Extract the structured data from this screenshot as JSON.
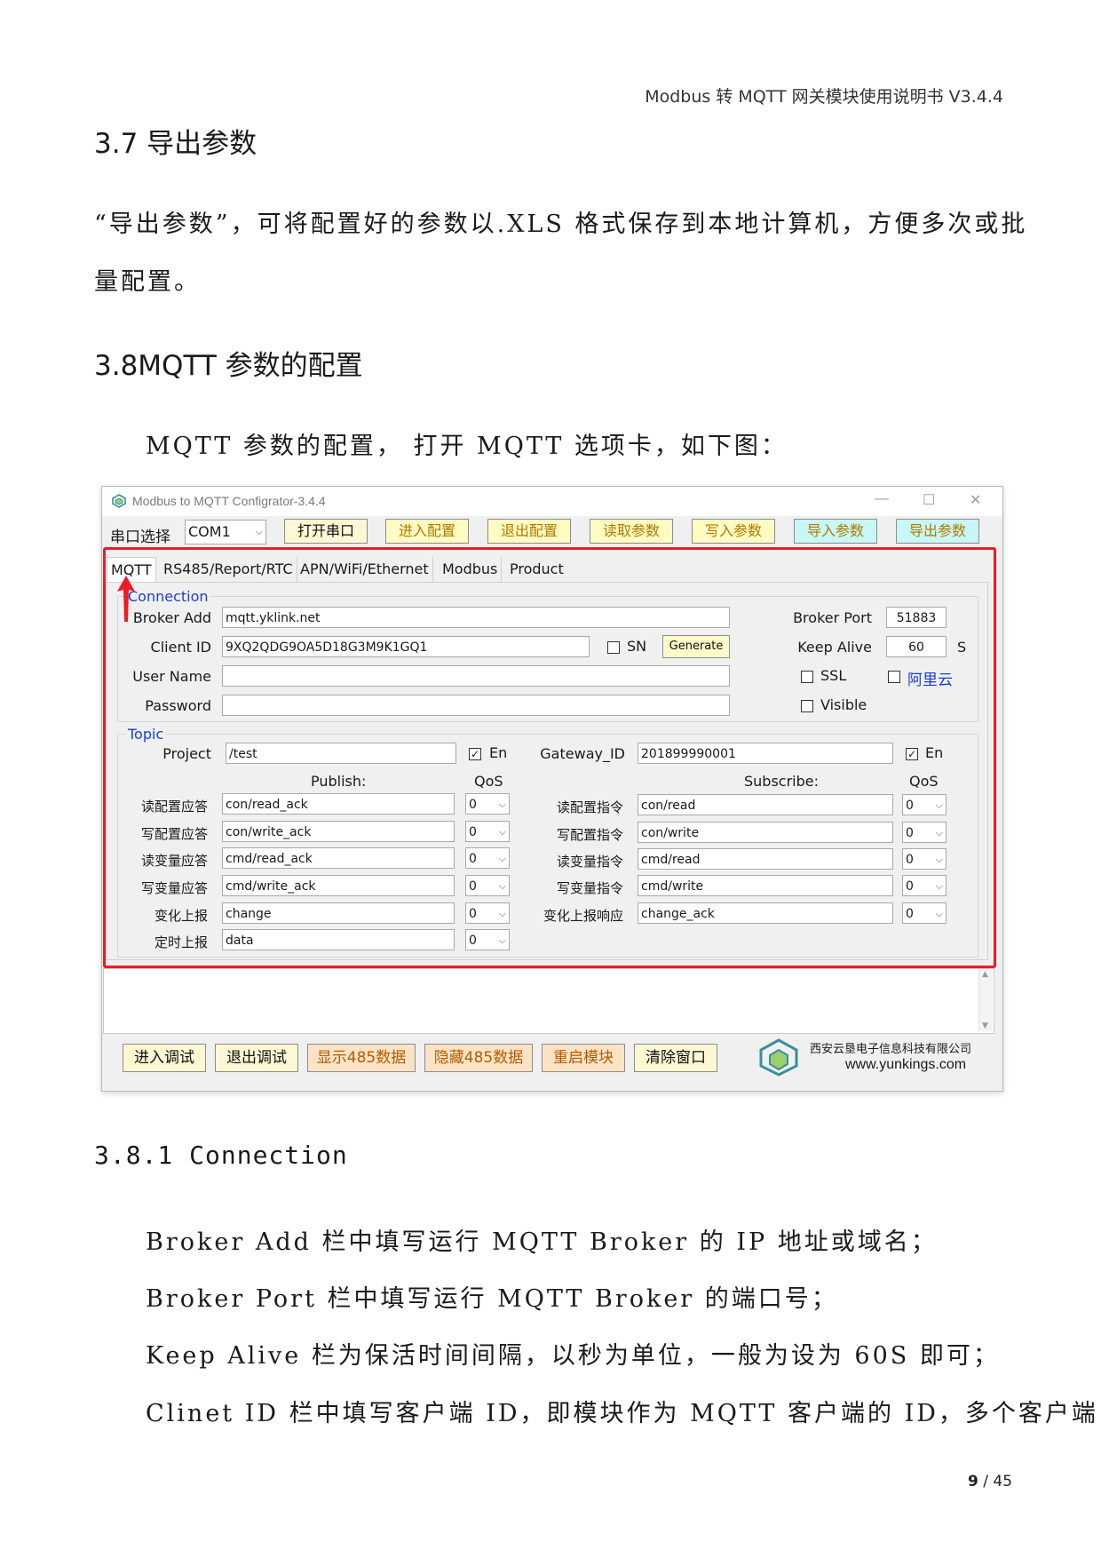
{
  "header": "Modbus 转 MQTT 网关模块使用说明书 V3.4.4",
  "s37": {
    "heading": "3.7 导出参数",
    "p1": "“导出参数”，可将配置好的参数以.XLS 格式保存到本地计算机，方便多次或批",
    "p2": "量配置。"
  },
  "s38": {
    "heading": "3.8MQTT 参数的配置",
    "intro": "MQTT 参数的配置，  打开 MQTT 选项卡，如下图："
  },
  "app": {
    "title": "Modbus to MQTT Configrator-3.4.4",
    "controls": [
      "—",
      "☐",
      "✕"
    ],
    "port_label": "串口选择",
    "port_value": "COM1",
    "toolbar": [
      "打开串口",
      "进入配置",
      "退出配置",
      "读取参数",
      "写入参数",
      "导入参数",
      "导出参数"
    ],
    "tabs": [
      "MQTT",
      "RS485/Report/RTC",
      "APN/WiFi/Ethernet",
      "Modbus",
      "Product"
    ],
    "connection": {
      "title": "Connection",
      "broker_add_label": "Broker Add",
      "broker_add": "mqtt.yklink.net",
      "client_id_label": "Client ID",
      "client_id": "9XQ2QDG9OA5D18G3M9K1GQ1",
      "sn_label": "SN",
      "generate": "Generate",
      "user_name_label": "User Name",
      "user_name": "",
      "password_label": "Password",
      "password": "",
      "broker_port_label": "Broker Port",
      "broker_port": "51883",
      "keep_alive_label": "Keep Alive",
      "keep_alive": "60",
      "keep_alive_unit": "S",
      "ssl_label": "SSL",
      "aliyun_label": "阿里云",
      "visible_label": "Visible"
    },
    "topic": {
      "title": "Topic",
      "project_label": "Project",
      "project": "/test",
      "en_label": "En",
      "gateway_label": "Gateway_ID",
      "gateway": "201899990001",
      "publish_header": "Publish:",
      "subscribe_header": "Subscribe:",
      "qos_header": "QoS",
      "publish": [
        {
          "label": "读配置应答",
          "topic": "con/read_ack",
          "qos": "0"
        },
        {
          "label": "写配置应答",
          "topic": "con/write_ack",
          "qos": "0"
        },
        {
          "label": "读变量应答",
          "topic": "cmd/read_ack",
          "qos": "0"
        },
        {
          "label": "写变量应答",
          "topic": "cmd/write_ack",
          "qos": "0"
        },
        {
          "label": "变化上报",
          "topic": "change",
          "qos": "0"
        },
        {
          "label": "定时上报",
          "topic": "data",
          "qos": "0"
        }
      ],
      "subscribe": [
        {
          "label": "读配置指令",
          "topic": "con/read",
          "qos": "0"
        },
        {
          "label": "写配置指令",
          "topic": "con/write",
          "qos": "0"
        },
        {
          "label": "读变量指令",
          "topic": "cmd/read",
          "qos": "0"
        },
        {
          "label": "写变量指令",
          "topic": "cmd/write",
          "qos": "0"
        },
        {
          "label": "变化上报响应",
          "topic": "change_ack",
          "qos": "0"
        }
      ]
    },
    "bottom_buttons": [
      "进入调试",
      "退出调试",
      "显示485数据",
      "隐藏485数据",
      "重启模块",
      "清除窗口"
    ],
    "company": "西安云垦电子信息科技有限公司",
    "website": "www.yunkings.com"
  },
  "s381": {
    "heading": "3.8.1 Connection",
    "lines": [
      "Broker Add 栏中填写运行 MQTT Broker 的 IP 地址或域名；",
      "Broker Port 栏中填写运行 MQTT Broker 的端口号；",
      "Keep Alive 栏为保活时间间隔，以秒为单位，一般为设为 60S 即可；",
      "Clinet  ID 栏中填写客户端 ID，即模块作为 MQTT 客户端的 ID，多个客户端"
    ]
  },
  "page": {
    "current": "9",
    "sep": " / ",
    "total": "45"
  }
}
